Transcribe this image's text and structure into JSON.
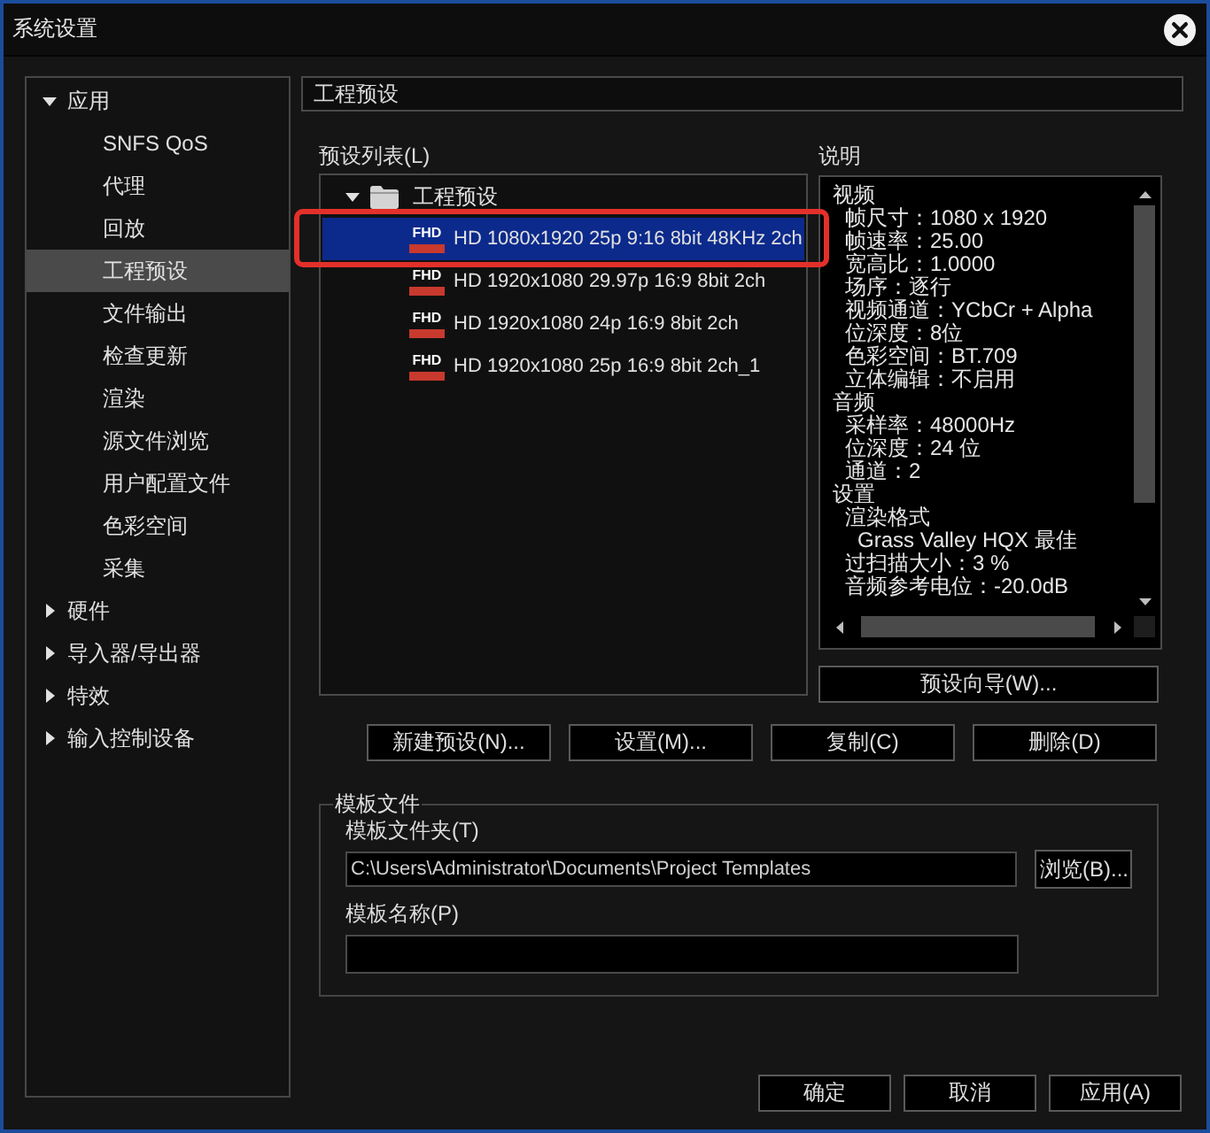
{
  "window": {
    "title": "系统设置"
  },
  "sidebar": {
    "items": [
      {
        "label": "应用",
        "expanded": true,
        "selected": false,
        "children": [
          {
            "label": "SNFS QoS",
            "selected": false
          },
          {
            "label": "代理",
            "selected": false
          },
          {
            "label": "回放",
            "selected": false
          },
          {
            "label": "工程预设",
            "selected": true
          },
          {
            "label": "文件输出",
            "selected": false
          },
          {
            "label": "检查更新",
            "selected": false
          },
          {
            "label": "渲染",
            "selected": false
          },
          {
            "label": "源文件浏览",
            "selected": false
          },
          {
            "label": "用户配置文件",
            "selected": false
          },
          {
            "label": "色彩空间",
            "selected": false
          },
          {
            "label": "采集",
            "selected": false
          }
        ]
      },
      {
        "label": "硬件",
        "expanded": false,
        "selected": false
      },
      {
        "label": "导入器/导出器",
        "expanded": false,
        "selected": false
      },
      {
        "label": "特效",
        "expanded": false,
        "selected": false
      },
      {
        "label": "输入控制设备",
        "expanded": false,
        "selected": false
      }
    ]
  },
  "page_header": "工程预设",
  "preset_list": {
    "label": "预设列表(L)",
    "folder": {
      "label": "工程预设",
      "expanded": true,
      "selected": false,
      "children": [
        {
          "badge": "FHD",
          "label": "HD 1080x1920 25p 9:16 8bit 48KHz 2ch",
          "selected": true,
          "highlighted": true
        },
        {
          "badge": "FHD",
          "label": "HD 1920x1080 29.97p 16:9 8bit 2ch",
          "selected": false,
          "highlighted": false
        },
        {
          "badge": "FHD",
          "label": "HD 1920x1080 24p 16:9 8bit 2ch",
          "selected": false,
          "highlighted": false
        },
        {
          "badge": "FHD",
          "label": "HD 1920x1080 25p 16:9 8bit 2ch_1",
          "selected": false,
          "highlighted": false
        }
      ]
    }
  },
  "description": {
    "label": "说明",
    "lines": [
      {
        "text": "视频",
        "children": [
          {
            "text": "帧尺寸：1080 x 1920"
          },
          {
            "text": "帧速率：25.00"
          },
          {
            "text": "宽高比：1.0000"
          },
          {
            "text": "场序：逐行"
          },
          {
            "text": "视频通道：YCbCr + Alpha"
          },
          {
            "text": "位深度：8位"
          },
          {
            "text": "色彩空间：BT.709"
          },
          {
            "text": "立体编辑：不启用"
          }
        ]
      },
      {
        "text": "音频",
        "children": [
          {
            "text": "采样率：48000Hz"
          },
          {
            "text": "位深度：24 位"
          },
          {
            "text": "通道：2"
          }
        ]
      },
      {
        "text": "设置",
        "children": [
          {
            "text": "渲染格式",
            "children": [
              {
                "text": "Grass Valley HQX 最佳"
              }
            ]
          },
          {
            "text": "过扫描大小：3 %"
          },
          {
            "text": "音频参考电位：-20.0dB"
          }
        ]
      }
    ]
  },
  "wizard_button": "预设向导(W)...",
  "preset_buttons": [
    "新建预设(N)...",
    "设置(M)...",
    "复制(C)",
    "删除(D)"
  ],
  "template_files": {
    "title": "模板文件",
    "folder_label": "模板文件夹(T)",
    "folder_value": "C:\\Users\\Administrator\\Documents\\Project Templates",
    "browse_button": "浏览(B)...",
    "name_label": "模板名称(P)"
  },
  "dialog_buttons": [
    "确定",
    "取消",
    "应用(A)"
  ]
}
